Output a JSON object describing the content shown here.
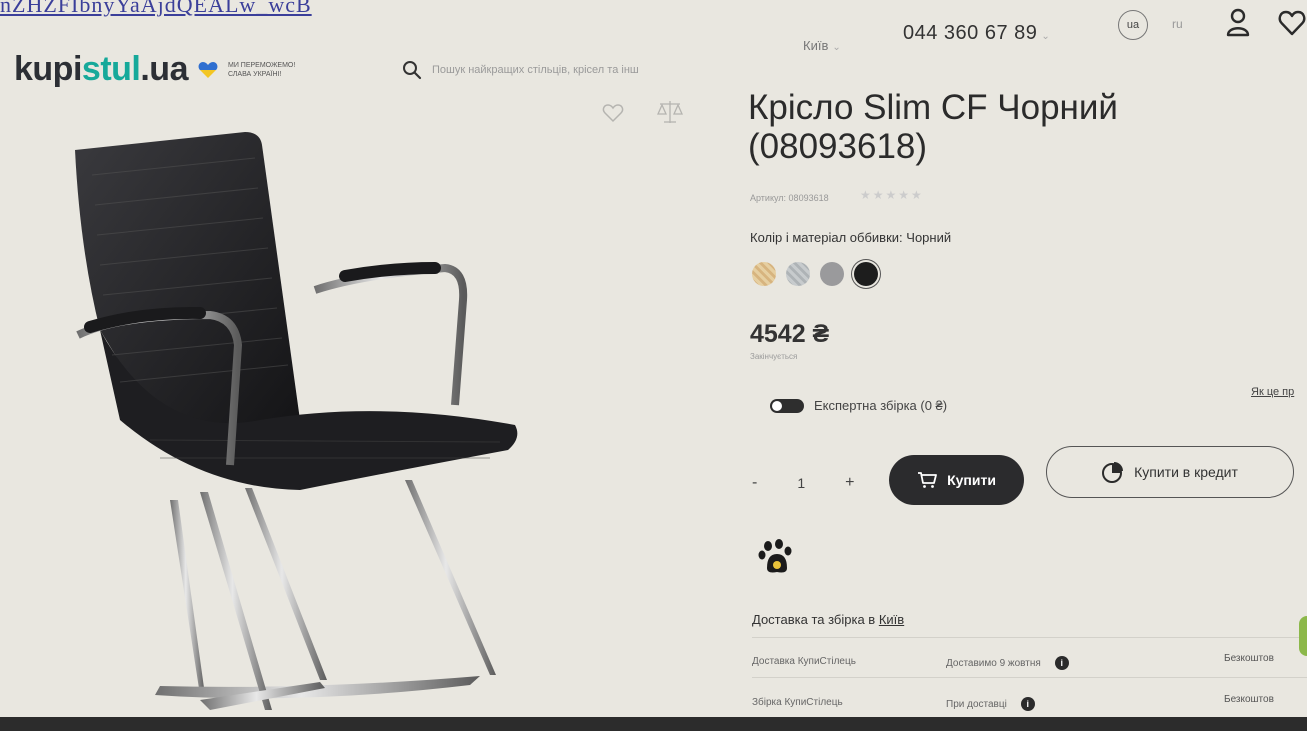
{
  "url_fragment": "nZHZFIbnyYaAjdQEALw_wcB",
  "header": {
    "logo": {
      "prefix": "kupi",
      "accent": "stul",
      "suffix": ".ua",
      "slogan": "МИ ПЕРЕМОЖЕМО! СЛАВА УКРАЇНІ!"
    },
    "search": {
      "placeholder": "Пошук найкращих стільців, крісел та інш"
    },
    "city": "Київ",
    "phone": "044 360 67 89",
    "lang_active": "ua",
    "lang_other": "ru"
  },
  "product": {
    "title": "Крісло Slim CF Чорний (08093618)",
    "sku": "Артикул: 08093618",
    "color_label": "Колір і матеріал оббивки:",
    "color_value": "Чорний",
    "swatch_colors": [
      "#e6cfa1",
      "#c7cbcd",
      "#9a9a9c",
      "#1d1d1d"
    ],
    "selected_swatch": 3,
    "price": "4542 ₴",
    "price_note": "Закінчується",
    "assembly_label": "Експертна збірка (0 ₴)",
    "assembly_link": "Як це пр",
    "quantity": "1",
    "qty_minus": "-",
    "qty_plus": "+",
    "buy_label": "Купити",
    "credit_label": "Купити в кредит"
  },
  "delivery": {
    "title_prefix": "Доставка та збірка в",
    "city": "Київ",
    "rows": [
      {
        "name": "Доставка КупиСтілець",
        "detail": "Доставимо 9 жовтня",
        "price": "Безкоштов"
      },
      {
        "name": "Збірка КупиСтілець",
        "detail": "При доставці",
        "price": "Безкоштов"
      }
    ]
  },
  "colors": {
    "accent": "#16a99a",
    "button_dark": "#2b2b2d",
    "background": "#e9e7e0"
  }
}
